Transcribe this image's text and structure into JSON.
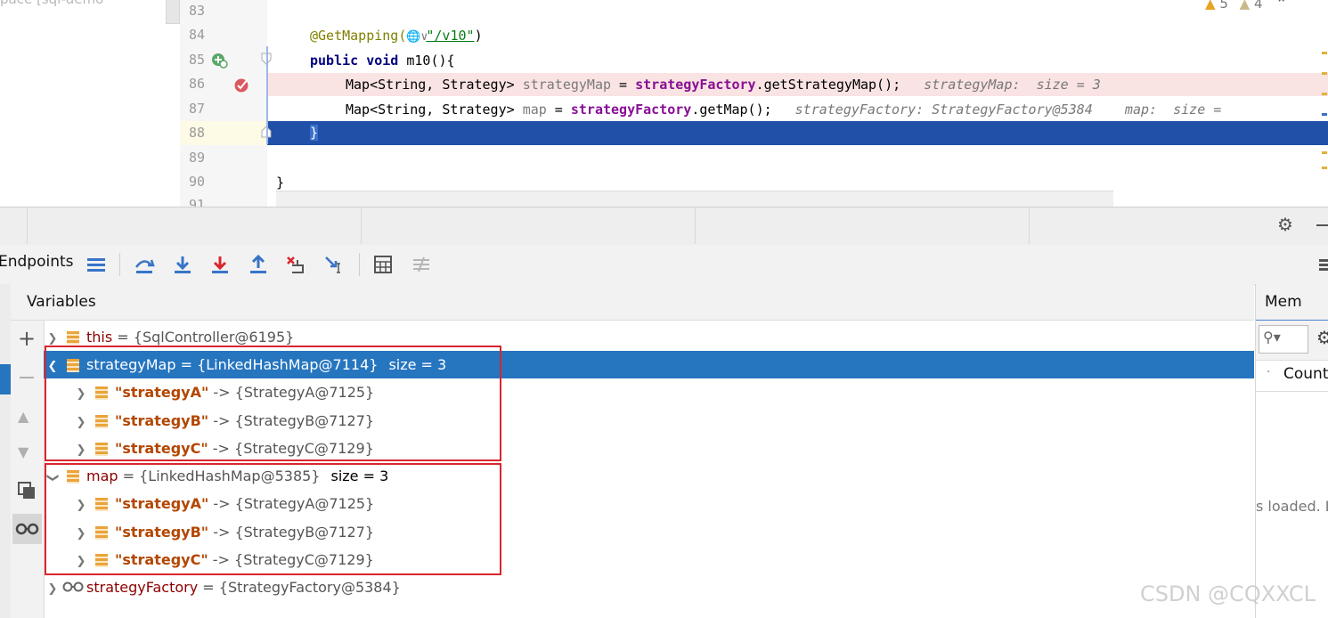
{
  "editor": {
    "project_label": "pace [sql-demo",
    "line_numbers": [
      "83",
      "84",
      "85",
      "86",
      "87",
      "88",
      "89",
      "90",
      "91"
    ],
    "inspections": {
      "warnings": "5",
      "weak_warnings": "4"
    },
    "code": {
      "l84_annotation": "@GetMapping(",
      "l84_path": "\"/v10\"",
      "l84_close": ")",
      "l85_kw": "public void",
      "l85_rest": " m10(){",
      "l86_type": "Map<String, Strategy> ",
      "l86_var": "strategyMap",
      "l86_eq": " = ",
      "l86_field": "strategyFactory",
      "l86_call": ".getStrategyMap();",
      "l86_inline": "strategyMap:  size = 3",
      "l87_type": "Map<String, Strategy> ",
      "l87_var": "map",
      "l87_eq": " = ",
      "l87_field": "strategyFactory",
      "l87_call": ".getMap();",
      "l87_inline": "strategyFactory: StrategyFactory@5384    map:  size =",
      "l88": "}",
      "l90": "}"
    }
  },
  "toolbar": {
    "endpoints_label": "Endpoints"
  },
  "variables": {
    "title": "Variables",
    "rows": [
      {
        "name": "this",
        "eq": " = ",
        "value": "{SqlController@6195}",
        "size": ""
      },
      {
        "name": "strategyMap",
        "eq": " = ",
        "value": "{LinkedHashMap@7114}",
        "size": "size = 3"
      },
      {
        "key": "\"strategyA\"",
        "arrow": " -> ",
        "value": "{StrategyA@7125}"
      },
      {
        "key": "\"strategyB\"",
        "arrow": " -> ",
        "value": "{StrategyB@7127}"
      },
      {
        "key": "\"strategyC\"",
        "arrow": " -> ",
        "value": "{StrategyC@7129}"
      },
      {
        "name": "map",
        "eq": " = ",
        "value": "{LinkedHashMap@5385}",
        "size": "size = 3"
      },
      {
        "key": "\"strategyA\"",
        "arrow": " -> ",
        "value": "{StrategyA@7125}"
      },
      {
        "key": "\"strategyB\"",
        "arrow": " -> ",
        "value": "{StrategyB@7127}"
      },
      {
        "key": "\"strategyC\"",
        "arrow": " -> ",
        "value": "{StrategyC@7129}"
      },
      {
        "name": "strategyFactory",
        "eq": " = ",
        "value": "{StrategyFactory@5384}",
        "size": ""
      }
    ]
  },
  "right_panel": {
    "tab": "Mem",
    "count_header": "Count",
    "loaded_text": "s loaded. L"
  },
  "watermark": "CSDN @CQXXCL",
  "colors": {
    "selection": "#2675bf",
    "execution_line": "#2150a8",
    "breakpoint_line": "#fae3e3",
    "highlight_box": "#d9262e"
  }
}
